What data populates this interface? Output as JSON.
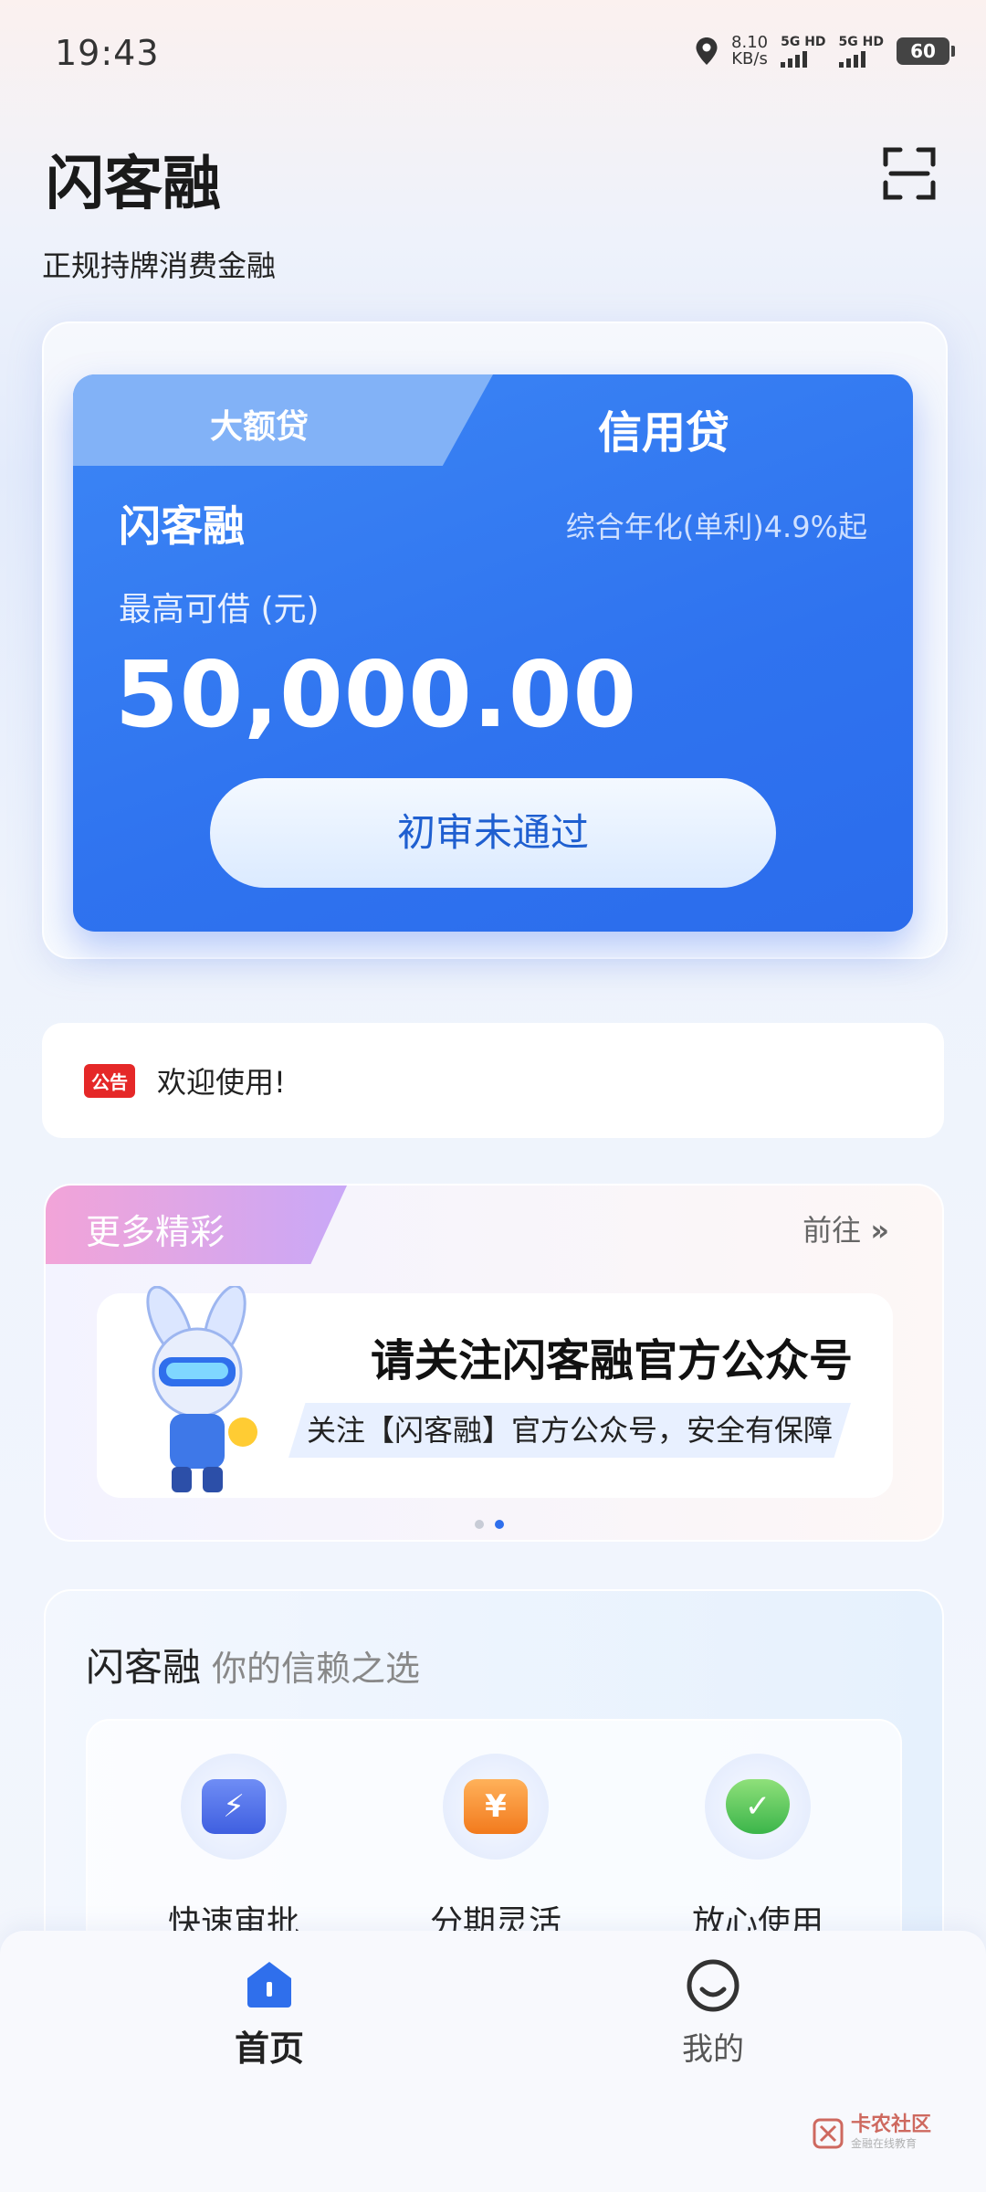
{
  "status": {
    "time": "19:43",
    "speed_value": "8.10",
    "speed_unit": "KB/s",
    "sim1": "5G HD",
    "sim2": "5G HD",
    "battery": "60"
  },
  "header": {
    "app_name": "闪客融",
    "subtitle": "正规持牌消费金融"
  },
  "loan_card": {
    "tab_inactive": "大额贷",
    "tab_active": "信用贷",
    "product_name": "闪客融",
    "rate_text": "综合年化(单利)4.9%起",
    "max_label": "最高可借 (元)",
    "amount": "50,000.00",
    "button_label": "初审未通过"
  },
  "notice": {
    "badge": "公告",
    "text": "欢迎使用!"
  },
  "more": {
    "title": "更多精彩",
    "link": "前往",
    "banner_title": "请关注闪客融官方公众号",
    "banner_sub": "关注【闪客融】官方公众号，安全有保障",
    "carousel_active_index": 1
  },
  "features": {
    "title": "闪客融",
    "tagline": "你的信赖之选",
    "items": [
      {
        "label": "快速审批",
        "icon": "lightning-icon"
      },
      {
        "label": "分期灵活",
        "icon": "yuan-icon"
      },
      {
        "label": "放心使用",
        "icon": "check-shield-icon"
      }
    ]
  },
  "nav": {
    "home": "首页",
    "mine": "我的"
  },
  "watermark": {
    "text": "卡农社区",
    "sub": "金融在线教育"
  },
  "colors": {
    "primary": "#2f73ef",
    "notice_red": "#e52828"
  }
}
